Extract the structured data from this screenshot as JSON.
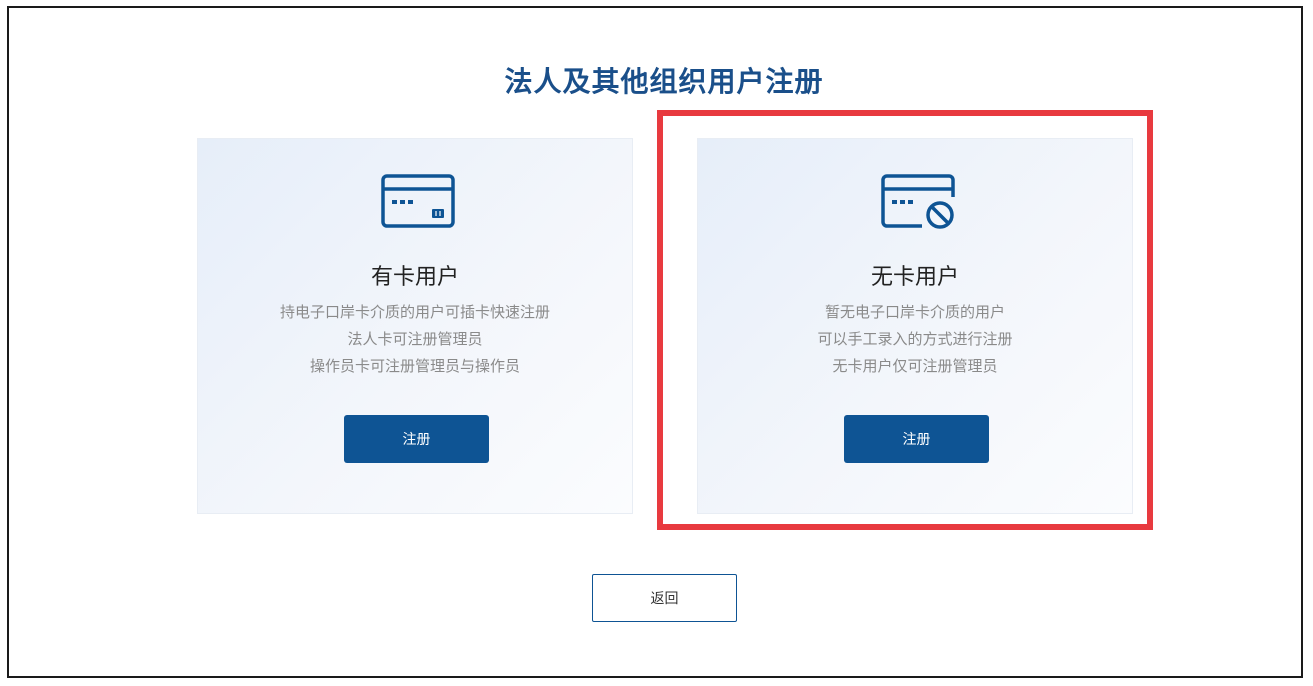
{
  "page": {
    "title": "法人及其他组织用户注册"
  },
  "cards": [
    {
      "icon": "credit-card-icon",
      "title": "有卡用户",
      "description": [
        "持电子口岸卡介质的用户可插卡快速注册",
        "法人卡可注册管理员",
        "操作员卡可注册管理员与操作员"
      ],
      "button_label": "注册"
    },
    {
      "icon": "credit-card-disabled-icon",
      "title": "无卡用户",
      "description": [
        "暂无电子口岸卡介质的用户",
        "可以手工录入的方式进行注册",
        "无卡用户仅可注册管理员"
      ],
      "button_label": "注册",
      "highlighted": true
    }
  ],
  "footer": {
    "back_label": "返回"
  },
  "colors": {
    "brand_blue": "#0e5494",
    "title_blue": "#1a4f8a",
    "highlight_red": "#e83a3f"
  }
}
